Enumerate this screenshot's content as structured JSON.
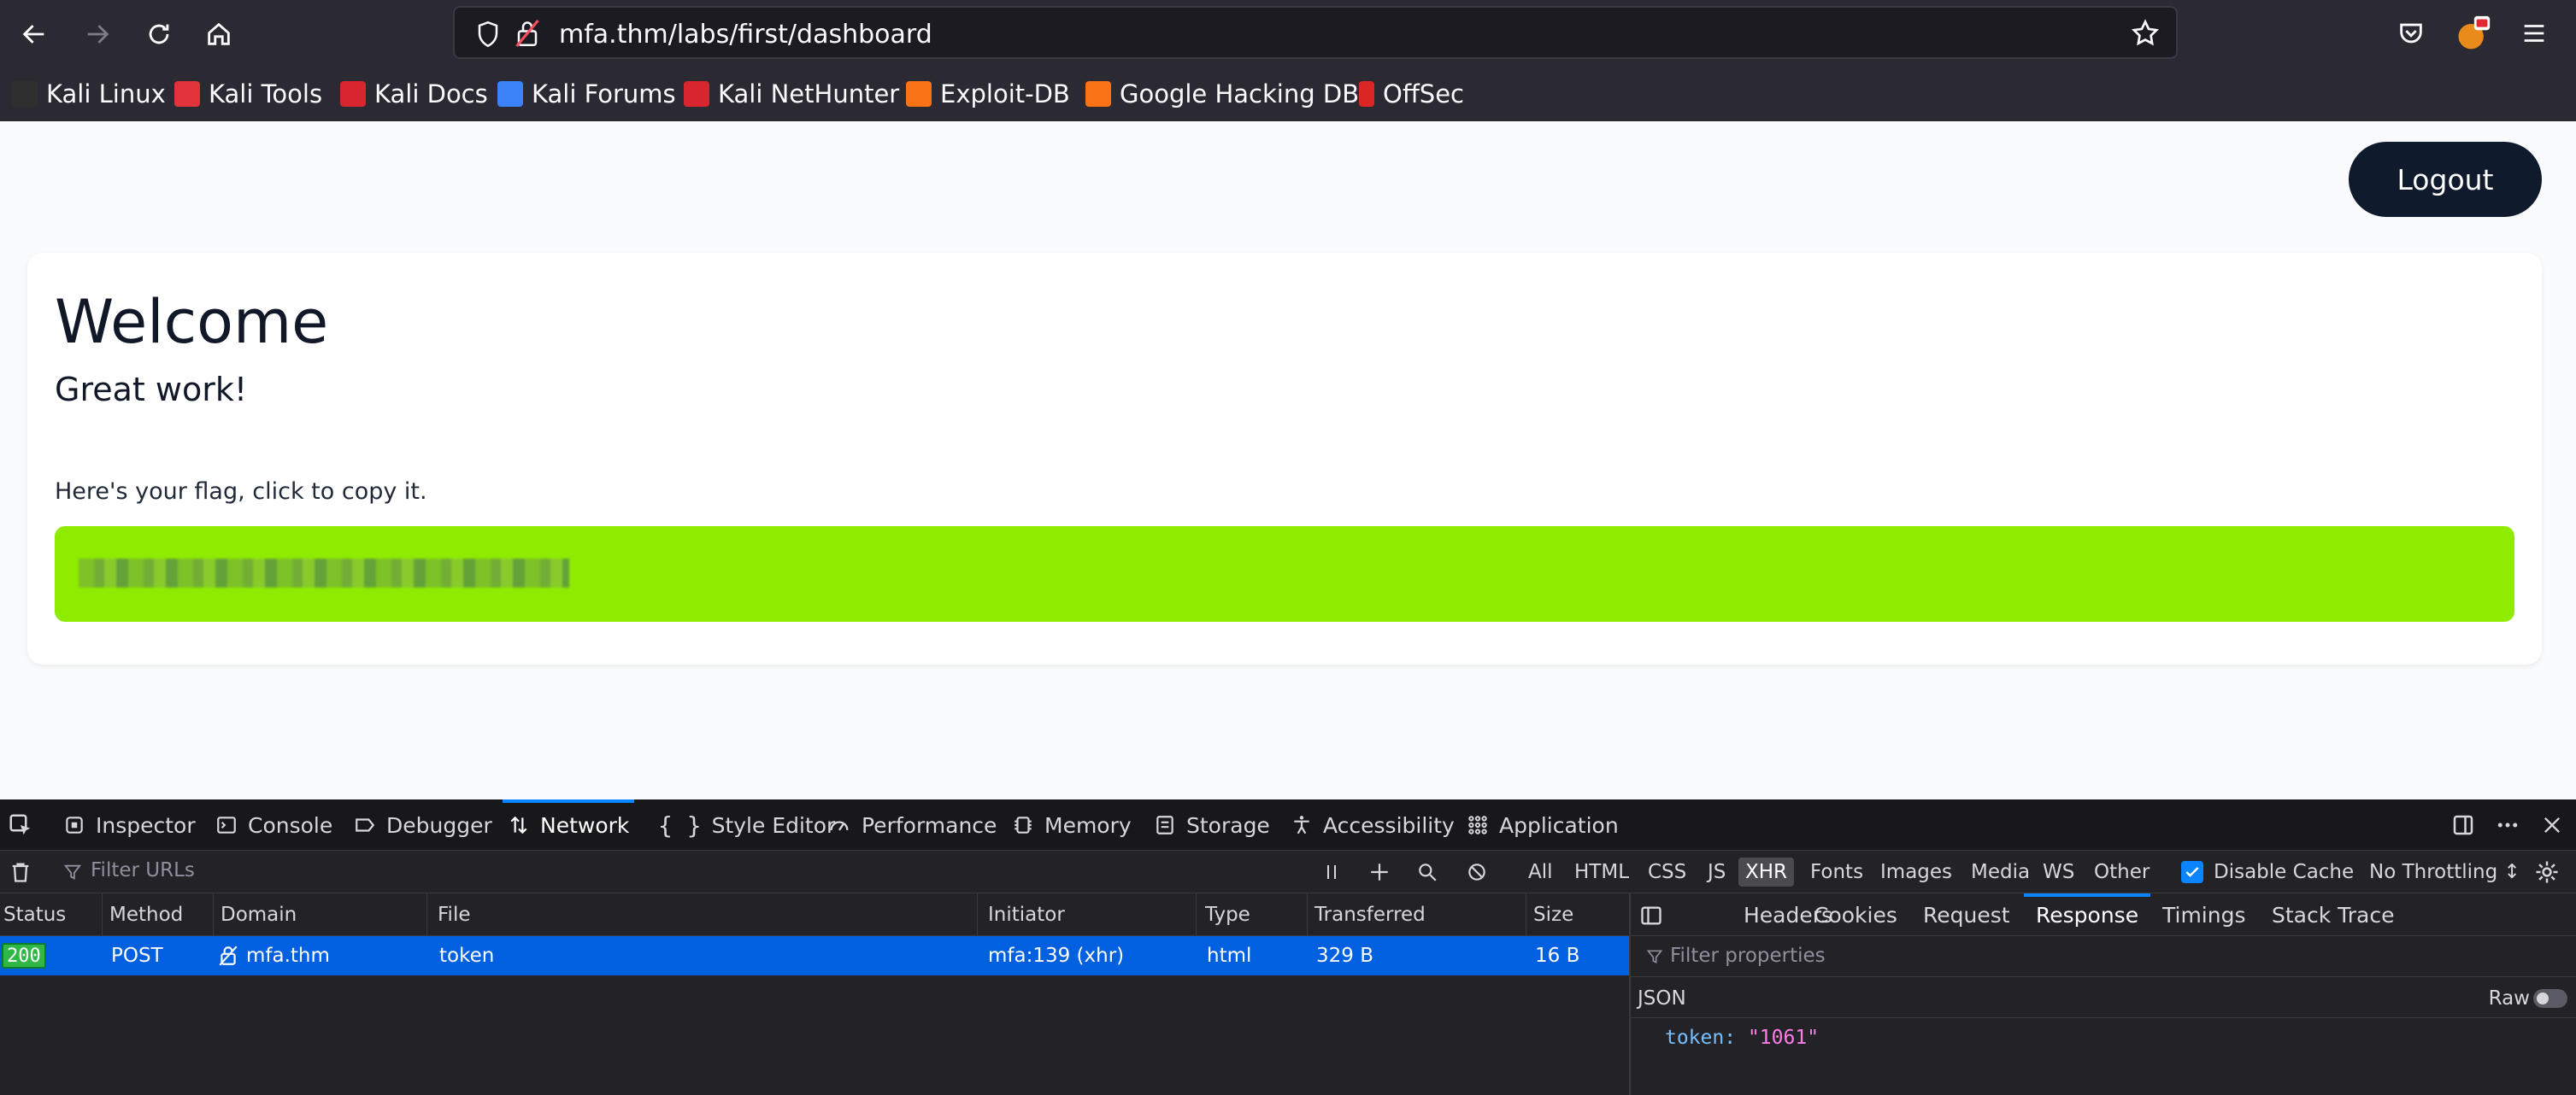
{
  "browser": {
    "url": "mfa.thm/labs/first/dashboard",
    "bookmarks": [
      {
        "label": "Kali Linux",
        "color": "#2f2f2f"
      },
      {
        "label": "Kali Tools",
        "color": "#e2323a"
      },
      {
        "label": "Kali Docs",
        "color": "#d7262e"
      },
      {
        "label": "Kali Forums",
        "color": "#3b82f6"
      },
      {
        "label": "Kali NetHunter",
        "color": "#d7262e"
      },
      {
        "label": "Exploit-DB",
        "color": "#f97316"
      },
      {
        "label": "Google Hacking DB",
        "color": "#f97316"
      },
      {
        "label": "OffSec",
        "color": "#dc2626"
      }
    ]
  },
  "page": {
    "logout_label": "Logout",
    "welcome": "Welcome",
    "subtitle": "Great work!",
    "flag_prompt": "Here's your flag, click to copy it.",
    "flag_color": "#8fec00"
  },
  "devtools": {
    "tabs": [
      "Inspector",
      "Console",
      "Debugger",
      "Network",
      "Style Editor",
      "Performance",
      "Memory",
      "Storage",
      "Accessibility",
      "Application"
    ],
    "active_tab": "Network",
    "filter_placeholder": "Filter URLs",
    "filter_types": [
      "All",
      "HTML",
      "CSS",
      "JS",
      "XHR",
      "Fonts",
      "Images",
      "Media",
      "WS",
      "Other"
    ],
    "active_filter": "XHR",
    "disable_cache_label": "Disable Cache",
    "throttling_label": "No Throttling ↕",
    "columns": [
      "Status",
      "Method",
      "Domain",
      "File",
      "Initiator",
      "Type",
      "Transferred",
      "Size"
    ],
    "request": {
      "status": "200",
      "method": "POST",
      "domain": "mfa.thm",
      "file": "token",
      "initiator": "mfa:139 (xhr)",
      "type": "html",
      "transferred": "329 B",
      "size": "16 B"
    },
    "side_tabs": [
      "Headers",
      "Cookies",
      "Request",
      "Response",
      "Timings",
      "Stack Trace"
    ],
    "active_side_tab": "Response",
    "filter_properties_placeholder": "Filter properties",
    "json_label": "JSON",
    "raw_label": "Raw",
    "response_key": "token:",
    "response_value": "\"1061\""
  }
}
